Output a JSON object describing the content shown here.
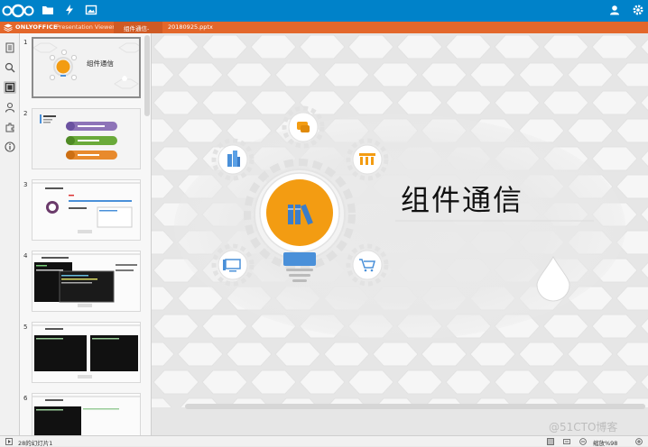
{
  "header": {
    "brand": "ONLYOFFICE",
    "product": "Presentation Viewer",
    "tab_label": "组件通信-",
    "file_name": "20180925.pptx"
  },
  "slide": {
    "title": "组件通信"
  },
  "thumbnails": [
    {
      "number": "1",
      "caption": "组件通信"
    },
    {
      "number": "2"
    },
    {
      "number": "3"
    },
    {
      "number": "4"
    },
    {
      "number": "5"
    },
    {
      "number": "6"
    }
  ],
  "status": {
    "slide_count": "28的幻灯片1",
    "zoom_label": "缩放%98"
  },
  "watermark": "@51CTO博客",
  "colors": {
    "topbar": "#0082c9",
    "headbar": "#e3672b",
    "bulb_orange": "#f39c12",
    "accent_blue": "#4a90d9"
  }
}
